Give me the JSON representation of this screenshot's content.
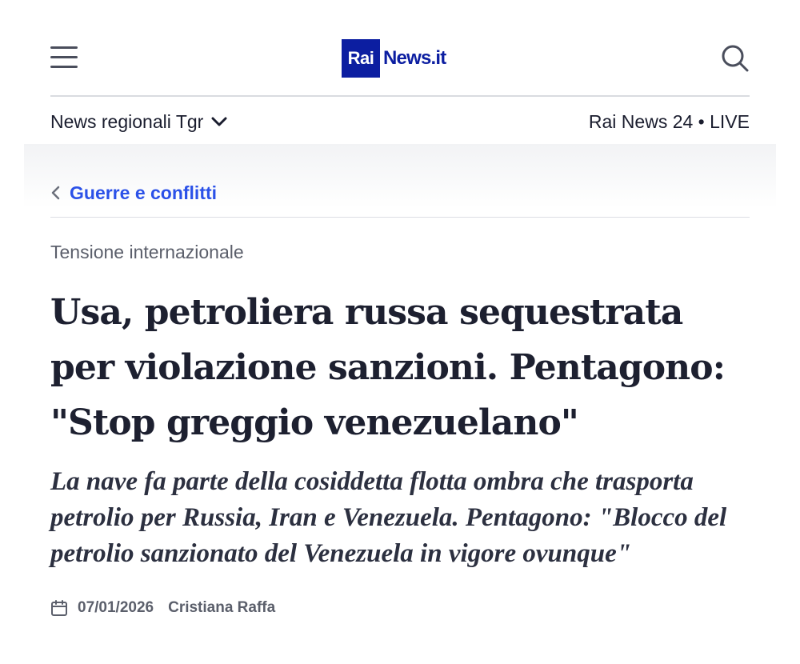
{
  "header": {
    "menu_icon": "hamburger-icon",
    "logo_box": "Rai",
    "logo_text": "News.it",
    "search_icon": "search-icon",
    "brand_color": "#0c1ea1"
  },
  "subnav": {
    "regional_label": "News regionali Tgr",
    "regional_icon": "chevron-down-icon",
    "live_label": "Rai News 24 • LIVE"
  },
  "breadcrumb": {
    "icon": "chevron-left-icon",
    "label": "Guerre e conflitti",
    "color": "#2b51e8"
  },
  "article": {
    "kicker": "Tensione internazionale",
    "headline": "Usa, petroliera russa sequestrata per violazione sanzioni. Pentagono: \"Stop greggio venezuelano\"",
    "subtitle": "La nave fa parte della cosiddetta flotta ombra che trasporta petrolio per Russia, Iran e Venezuela. Pentagono: \"Blocco del petrolio sanzionato del Venezuela in vigore ovunque\"",
    "date_icon": "calendar-icon",
    "date": "07/01/2026",
    "author": "Cristiana Raffa"
  }
}
